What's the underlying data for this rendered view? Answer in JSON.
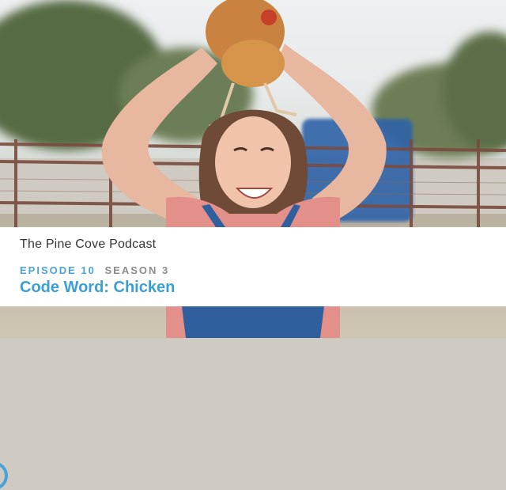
{
  "banner": {
    "show_name": "The Pine Cove Podcast",
    "episode_label": "EPISODE 10",
    "season_label": "SEASON 3",
    "episode_title": "Code Word: Chicken"
  },
  "colors": {
    "accent": "#4aa3d8",
    "title": "#3b9fd6",
    "banner_bg": "#ffffff",
    "season_text": "#8b8b8b"
  },
  "photo": {
    "subject": "smiling girl holding a chicken overhead",
    "icon": "circle-badge-icon"
  }
}
